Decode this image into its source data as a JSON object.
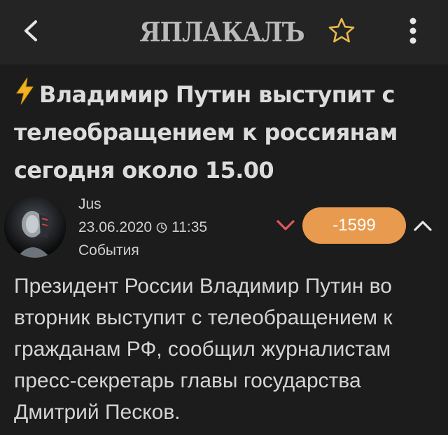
{
  "header": {
    "logo_text": "ЯПЛАКАЛЪ",
    "back_icon": "chevron-left-icon",
    "favorite_icon": "star-outline-icon",
    "menu_icon": "more-vertical-icon"
  },
  "post": {
    "title": "Владимир Путин выступит с телеобращением к россиянам сегодня около 15.00",
    "title_icon": "lightning-icon",
    "author": "Jus",
    "date": "23.06.2020",
    "time": "11:35",
    "category": "События",
    "rating": "-1599",
    "body": "Президент России Владимир Путин во вторник выступит с телеобращением к гражданам РФ, сообщил журналистам пресс-секретарь главы государства Дмитрий Песков."
  },
  "colors": {
    "background": "#1c1c1c",
    "header": "#242424",
    "rating_badge": "#e89a4e",
    "vote_down": "#e0585a",
    "star": "#e8b84a",
    "bolt": "#f2b21f"
  }
}
